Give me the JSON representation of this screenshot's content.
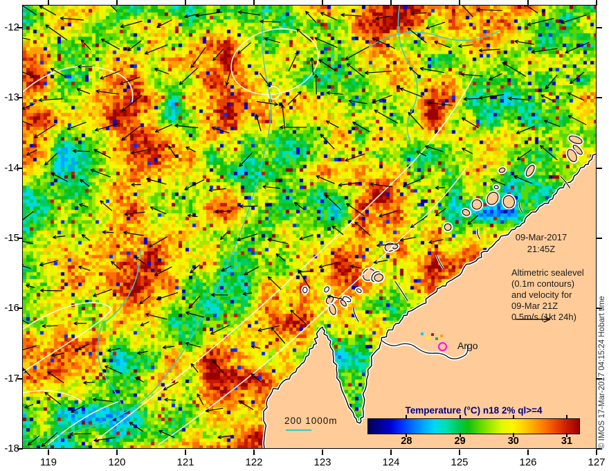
{
  "map": {
    "date_line1": "09-Mar-2017",
    "date_line2": "21:45Z",
    "altimetric_note": [
      "Altimetric sealevel",
      "(0.1m contours)",
      "and velocity for",
      "09-Mar 21Z",
      "0.5m/s (1kt 24h)"
    ],
    "argo_label": "Argo",
    "depth_legend": "200 1000m",
    "copyright": "© IMOS 17-Mar-2017 04:15:24 Hobart time"
  },
  "axes": {
    "lon_ticks": [
      "119",
      "120",
      "121",
      "122",
      "123",
      "124",
      "125",
      "126",
      "127"
    ],
    "lat_ticks": [
      "-12",
      "-13",
      "-14",
      "-15",
      "-16",
      "-17",
      "-18"
    ]
  },
  "colorbar": {
    "title": "Temperature (°C) n18 2% ql>=4",
    "tick_labels": [
      "28",
      "29",
      "30",
      "31"
    ],
    "tick_values": [
      28,
      29,
      30,
      31
    ],
    "value_range": [
      27.27,
      31.22
    ],
    "title_color": "#000080",
    "stops": [
      "#00005a",
      "#000090",
      "#0000d0",
      "#0030ff",
      "#0070ff",
      "#00a8ff",
      "#00d8f0",
      "#00e0b0",
      "#00cc60",
      "#10c010",
      "#58d800",
      "#a0e800",
      "#e0f800",
      "#fff400",
      "#ffd000",
      "#ffa000",
      "#ff7000",
      "#e84000",
      "#c41800",
      "#9a0000"
    ]
  },
  "colors": {
    "land": "#FFCC99",
    "shore_fringe": "#FFFFFF",
    "coast_outline": "#000000",
    "contour_white": "#FFFFF2",
    "bathymetry_cyan": "#3CC8C8",
    "argo_magenta": "#FF00FF",
    "vector_black": "#000000",
    "frame": "#000000",
    "background": "#FFFFFF"
  },
  "chart_data": {
    "type": "heatmap",
    "title": "Temperature (°C) n18 2% ql>=4",
    "x_axis": {
      "ticks": [
        119,
        120,
        121,
        122,
        123,
        124,
        125,
        126,
        127
      ],
      "range": [
        118.63,
        127
      ]
    },
    "y_axis": {
      "ticks": [
        -12,
        -13,
        -14,
        -15,
        -16,
        -17,
        -18
      ],
      "range": [
        -18,
        -11.68
      ]
    },
    "colorbar": {
      "ticks": [
        28,
        29,
        30,
        31
      ],
      "range_c": [
        27.27,
        31.22
      ]
    },
    "annotations": [
      "09-Mar-2017 21:45Z",
      "Altimetric sealevel (0.1m contours) and velocity for 09-Mar 21Z",
      "0.5m/s (1kt 24h)",
      "Argo",
      "200 1000m isobaths"
    ],
    "legend_position": "bottom-right-on-land",
    "grid": false
  }
}
